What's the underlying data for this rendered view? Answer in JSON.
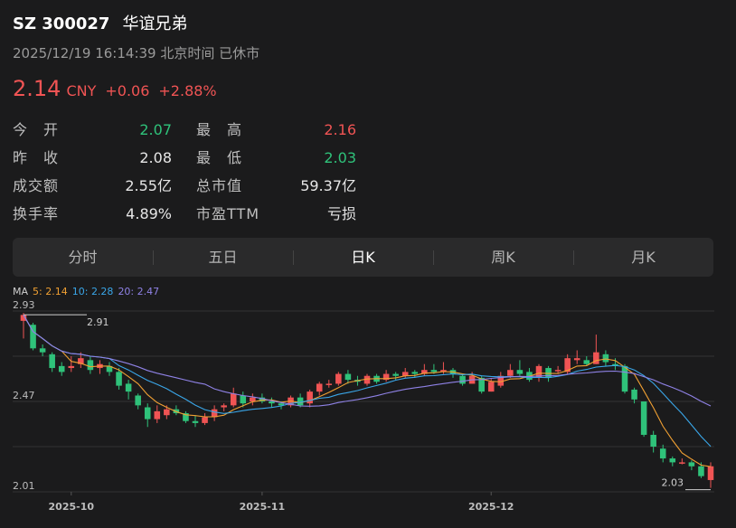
{
  "header": {
    "ticker": "SZ 300027",
    "name": "华谊兄弟",
    "datetime": "2025/12/19 16:14:39 北京时间 已休市"
  },
  "quote": {
    "price": "2.14",
    "currency": "CNY",
    "change": "+0.06",
    "change_pct": "+2.88%"
  },
  "stats": [
    {
      "label": "今　开",
      "value": "2.07",
      "label2": "最　高",
      "value2": "2.16"
    },
    {
      "label": "昨　收",
      "value": "2.08",
      "label2": "最　低",
      "value2": "2.03"
    },
    {
      "label": "成交额",
      "value": "2.55亿",
      "label2": "总市值",
      "value2": "59.37亿"
    },
    {
      "label": "换手率",
      "value": "4.89%",
      "label2": "市盈TTM",
      "value2": "亏损"
    }
  ],
  "tabs": [
    "分时",
    "五日",
    "日K",
    "周K",
    "月K"
  ],
  "active_tab": "日K",
  "ma_legend": {
    "label": "MA",
    "ma5_label": "5:",
    "ma5": "2.14",
    "ma10_label": "10:",
    "ma10": "2.28",
    "ma20_label": "20:",
    "ma20": "2.47"
  },
  "colors": {
    "up": "#f05454",
    "down": "#2fc27a",
    "ma5": "#f0a033",
    "ma10": "#3aa6e8",
    "ma20": "#8f82e6",
    "background": "#1b1b1c"
  },
  "chart_data": {
    "type": "candlestick",
    "y_tick_labels": [
      "2.93",
      "2.47",
      "2.01"
    ],
    "x_tick_labels": [
      "2025-10",
      "2025-11",
      "2025-12"
    ],
    "max_annotation": "2.91",
    "min_annotation": "2.03",
    "ylim": [
      2.01,
      2.93
    ],
    "candles": [
      [
        2.88,
        2.91,
        2.92,
        2.79
      ],
      [
        2.86,
        2.74,
        2.87,
        2.73
      ],
      [
        2.74,
        2.72,
        2.76,
        2.7
      ],
      [
        2.71,
        2.64,
        2.72,
        2.62
      ],
      [
        2.65,
        2.62,
        2.67,
        2.6
      ],
      [
        2.64,
        2.65,
        2.7,
        2.62
      ],
      [
        2.66,
        2.69,
        2.72,
        2.64
      ],
      [
        2.68,
        2.63,
        2.7,
        2.61
      ],
      [
        2.64,
        2.66,
        2.68,
        2.61
      ],
      [
        2.65,
        2.62,
        2.67,
        2.6
      ],
      [
        2.62,
        2.55,
        2.64,
        2.53
      ],
      [
        2.56,
        2.52,
        2.58,
        2.48
      ],
      [
        2.5,
        2.45,
        2.51,
        2.43
      ],
      [
        2.44,
        2.38,
        2.46,
        2.34
      ],
      [
        2.38,
        2.42,
        2.45,
        2.36
      ],
      [
        2.4,
        2.43,
        2.45,
        2.38
      ],
      [
        2.43,
        2.41,
        2.45,
        2.4
      ],
      [
        2.41,
        2.37,
        2.42,
        2.36
      ],
      [
        2.37,
        2.36,
        2.4,
        2.34
      ],
      [
        2.36,
        2.39,
        2.41,
        2.35
      ],
      [
        2.39,
        2.43,
        2.45,
        2.37
      ],
      [
        2.44,
        2.45,
        2.46,
        2.42
      ],
      [
        2.45,
        2.51,
        2.54,
        2.44
      ],
      [
        2.5,
        2.46,
        2.52,
        2.44
      ],
      [
        2.47,
        2.49,
        2.51,
        2.45
      ],
      [
        2.49,
        2.47,
        2.51,
        2.46
      ],
      [
        2.47,
        2.46,
        2.49,
        2.44
      ],
      [
        2.46,
        2.45,
        2.47,
        2.43
      ],
      [
        2.45,
        2.49,
        2.5,
        2.44
      ],
      [
        2.49,
        2.45,
        2.51,
        2.44
      ],
      [
        2.46,
        2.52,
        2.53,
        2.44
      ],
      [
        2.52,
        2.56,
        2.57,
        2.5
      ],
      [
        2.56,
        2.56,
        2.58,
        2.54
      ],
      [
        2.56,
        2.61,
        2.62,
        2.55
      ],
      [
        2.61,
        2.58,
        2.63,
        2.56
      ],
      [
        2.58,
        2.57,
        2.6,
        2.55
      ],
      [
        2.56,
        2.6,
        2.61,
        2.55
      ],
      [
        2.6,
        2.57,
        2.61,
        2.56
      ],
      [
        2.58,
        2.61,
        2.63,
        2.57
      ],
      [
        2.61,
        2.6,
        2.62,
        2.58
      ],
      [
        2.6,
        2.62,
        2.64,
        2.59
      ],
      [
        2.62,
        2.61,
        2.63,
        2.59
      ],
      [
        2.61,
        2.63,
        2.66,
        2.6
      ],
      [
        2.63,
        2.62,
        2.66,
        2.61
      ],
      [
        2.62,
        2.63,
        2.67,
        2.61
      ],
      [
        2.63,
        2.61,
        2.64,
        2.59
      ],
      [
        2.6,
        2.56,
        2.61,
        2.55
      ],
      [
        2.56,
        2.6,
        2.62,
        2.56
      ],
      [
        2.59,
        2.52,
        2.6,
        2.51
      ],
      [
        2.52,
        2.57,
        2.59,
        2.52
      ],
      [
        2.55,
        2.6,
        2.62,
        2.54
      ],
      [
        2.6,
        2.63,
        2.66,
        2.59
      ],
      [
        2.63,
        2.61,
        2.68,
        2.6
      ],
      [
        2.62,
        2.58,
        2.64,
        2.57
      ],
      [
        2.59,
        2.65,
        2.66,
        2.57
      ],
      [
        2.64,
        2.59,
        2.65,
        2.57
      ],
      [
        2.63,
        2.63,
        2.65,
        2.61
      ],
      [
        2.62,
        2.69,
        2.71,
        2.61
      ],
      [
        2.68,
        2.69,
        2.73,
        2.66
      ],
      [
        2.68,
        2.66,
        2.7,
        2.65
      ],
      [
        2.66,
        2.72,
        2.81,
        2.66
      ],
      [
        2.71,
        2.67,
        2.73,
        2.65
      ],
      [
        2.66,
        2.65,
        2.69,
        2.63
      ],
      [
        2.65,
        2.52,
        2.66,
        2.51
      ],
      [
        2.53,
        2.48,
        2.54,
        2.46
      ],
      [
        2.47,
        2.3,
        2.47,
        2.29
      ],
      [
        2.3,
        2.24,
        2.32,
        2.21
      ],
      [
        2.23,
        2.18,
        2.25,
        2.16
      ],
      [
        2.18,
        2.16,
        2.19,
        2.14
      ],
      [
        2.16,
        2.16,
        2.18,
        2.15
      ],
      [
        2.16,
        2.14,
        2.17,
        2.12
      ],
      [
        2.14,
        2.09,
        2.16,
        2.08
      ],
      [
        2.07,
        2.14,
        2.16,
        2.03
      ]
    ],
    "ma5_label": "MA5",
    "ma10_label": "MA10",
    "ma20_label": "MA20"
  }
}
